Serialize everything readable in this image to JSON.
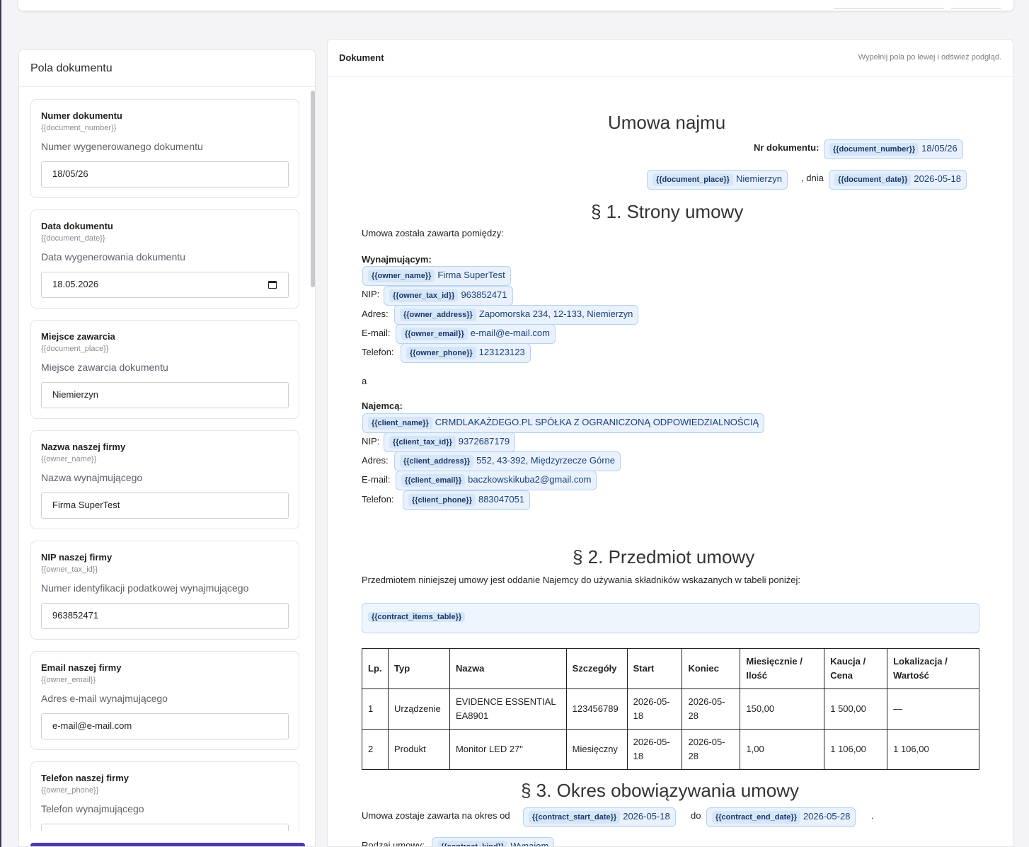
{
  "left_panel": {
    "title": "Pola dokumentu",
    "fields": [
      {
        "label": "Numer dokumentu",
        "placeholder": "{{document_number}}",
        "description": "Numer wygenerowanego dokumentu",
        "value": "18/05/26"
      },
      {
        "label": "Data dokumentu",
        "placeholder": "{{document_date}}",
        "description": "Data wygenerowania dokumentu",
        "value": "18.05.2026"
      },
      {
        "label": "Miejsce zawarcia",
        "placeholder": "{{document_place}}",
        "description": "Miejsce zawarcia dokumentu",
        "value": "Niemierzyn"
      },
      {
        "label": "Nazwa naszej firmy",
        "placeholder": "{{owner_name}}",
        "description": "Nazwa wynajmującego",
        "value": "Firma SuperTest"
      },
      {
        "label": "NIP naszej firmy",
        "placeholder": "{{owner_tax_id}}",
        "description": "Numer identyfikacji podatkowej wynajmującego",
        "value": "963852471"
      },
      {
        "label": "Email naszej firmy",
        "placeholder": "{{owner_email}}",
        "description": "Adres e-mail wynajmującego",
        "value": "e-mail@e-mail.com"
      },
      {
        "label": "Telefon naszej firmy",
        "placeholder": "{{owner_phone}}",
        "description": "Telefon wynajmującego",
        "value": ""
      }
    ]
  },
  "right_panel": {
    "title": "Dokument",
    "hint": "Wypełnij pola po lewej i odśwież podgląd."
  },
  "doc": {
    "title": "Umowa najmu",
    "nr_label": "Nr dokumentu:",
    "nr_tag": "{{document_number}}",
    "nr_value": "18/05/26",
    "place_tag": "{{document_place}}",
    "place_value": "Niemierzyn",
    "dnia": ", dnia",
    "date_tag": "{{document_date}}",
    "date_value": "2026-05-18",
    "s1_title": "§ 1. Strony umowy",
    "s1_intro": "Umowa została zawarta pomiędzy:",
    "owner_heading": "Wynajmującym:",
    "owner_name_tag": "{{owner_name}}",
    "owner_name": "Firma SuperTest",
    "nip_label": "NIP:",
    "owner_tax_tag": "{{owner_tax_id}}",
    "owner_tax": "963852471",
    "address_label": "Adres:",
    "owner_address_tag": "{{owner_address}}",
    "owner_address": "Zapomorska 234, 12-133, Niemierzyn",
    "email_label": "E-mail:",
    "owner_email_tag": "{{owner_email}}",
    "owner_email": "e-mail@e-mail.com",
    "phone_label": "Telefon:",
    "owner_phone_tag": "{{owner_phone}}",
    "owner_phone": "123123123",
    "and": "a",
    "client_heading": "Najemcą:",
    "client_name_tag": "{{client_name}}",
    "client_name": "CRMDLAKAŻDEGO.PL SPÓŁKA Z OGRANICZONĄ ODPOWIEDZIALNOŚCIĄ",
    "client_tax_tag": "{{client_tax_id}}",
    "client_tax": "9372687179",
    "client_address_tag": "{{client_address}}",
    "client_address": "552, 43-392, Międzyrzecze Górne",
    "client_email_tag": "{{client_email}}",
    "client_email": "baczkowskikuba2@gmail.com",
    "client_phone_tag": "{{client_phone}}",
    "client_phone": "883047051",
    "s2_title": "§ 2. Przedmiot umowy",
    "s2_intro": "Przedmiotem niniejszej umowy jest oddanie Najemcy do używania składników wskazanych w tabeli poniżej:",
    "items_tag": "{{contract_items_table}}",
    "table": {
      "headers": [
        "Lp.",
        "Typ",
        "Nazwa",
        "Szczegóły",
        "Start",
        "Koniec",
        "Miesięcznie / Ilość",
        "Kaucja / Cena",
        "Lokalizacja / Wartość"
      ],
      "rows": [
        [
          "1",
          "Urządzenie",
          "EVIDENCE ESSENTIAL EA8901",
          "123456789",
          "2026-05-18",
          "2026-05-28",
          "150,00",
          "1 500,00",
          "—"
        ],
        [
          "2",
          "Produkt",
          "Monitor LED 27\"",
          "Miesięczny",
          "2026-05-18",
          "2026-05-28",
          "1,00",
          "1 106,00",
          "1 106,00"
        ]
      ]
    },
    "s3_title": "§ 3. Okres obowiązywania umowy",
    "s3_text": "Umowa zostaje zawarta na okres od",
    "start_tag": "{{contract_start_date}}",
    "start_value": "2026-05-18",
    "do": "do",
    "end_tag": "{{contract_end_date}}",
    "end_value": "2026-05-28",
    "dot": ".",
    "kind_label": "Rodzaj umowy:",
    "kind_tag": "{{contract_kind}}",
    "kind_value": "Wynajem"
  }
}
